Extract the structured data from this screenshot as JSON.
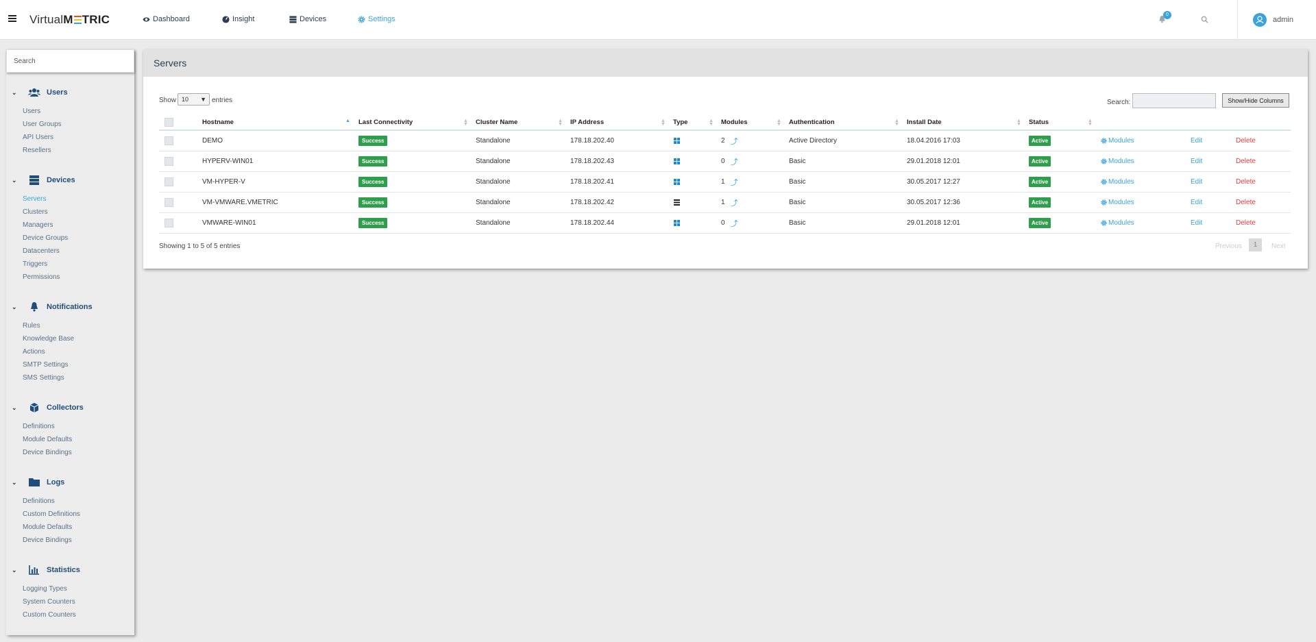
{
  "app": {
    "logo_prefix": "Virtual",
    "logo_m": "M",
    "logo_suffix": "TRIC"
  },
  "nav": {
    "items": [
      {
        "label": "Dashboard",
        "icon": "eye-icon"
      },
      {
        "label": "Insight",
        "icon": "gauge-icon"
      },
      {
        "label": "Devices",
        "icon": "server-icon"
      },
      {
        "label": "Settings",
        "icon": "gear-icon",
        "active": true
      }
    ],
    "notifications_count": "0",
    "user": "admin"
  },
  "sidebar": {
    "search_placeholder": "Search",
    "sections": [
      {
        "title": "Users",
        "icon": "users-icon",
        "items": [
          "Users",
          "User Groups",
          "API Users",
          "Resellers"
        ]
      },
      {
        "title": "Devices",
        "icon": "server-icon",
        "items": [
          "Servers",
          "Clusters",
          "Managers",
          "Device Groups",
          "Datacenters",
          "Triggers",
          "Permissions"
        ],
        "active_item": "Servers"
      },
      {
        "title": "Notifications",
        "icon": "bell-icon",
        "items": [
          "Rules",
          "Knowledge Base",
          "Actions",
          "SMTP Settings",
          "SMS Settings"
        ]
      },
      {
        "title": "Collectors",
        "icon": "cube-icon",
        "items": [
          "Definitions",
          "Module Defaults",
          "Device Bindings"
        ]
      },
      {
        "title": "Logs",
        "icon": "folder-icon",
        "items": [
          "Definitions",
          "Custom Definitions",
          "Module Defaults",
          "Device Bindings"
        ]
      },
      {
        "title": "Statistics",
        "icon": "bar-chart-icon",
        "items": [
          "Logging Types",
          "System Counters",
          "Custom Counters"
        ]
      }
    ]
  },
  "panel": {
    "title": "Servers",
    "show_label": "Show",
    "entries_value": "10",
    "entries_suffix": "entries",
    "search_label": "Search:",
    "columns_button": "Show/Hide Columns",
    "info": "Showing 1 to 5 of 5 entries",
    "pager": {
      "previous": "Previous",
      "page": "1",
      "next": "Next"
    }
  },
  "table": {
    "headers": [
      "Hostname",
      "Last Connectivity",
      "Cluster Name",
      "IP Address",
      "Type",
      "Modules",
      "Authentication",
      "Install Date",
      "Status"
    ],
    "action_labels": {
      "modules": "Modules",
      "edit": "Edit",
      "delete": "Delete"
    },
    "rows": [
      {
        "hostname": "DEMO",
        "connectivity": "Success",
        "cluster": "Standalone",
        "ip": "178.18.202.40",
        "type": "windows-icon",
        "modules": "2",
        "auth": "Active Directory",
        "install_date": "18.04.2016 17:03",
        "status": "Active"
      },
      {
        "hostname": "HYPERV-WIN01",
        "connectivity": "Success",
        "cluster": "Standalone",
        "ip": "178.18.202.43",
        "type": "windows-icon",
        "modules": "0",
        "auth": "Basic",
        "install_date": "29.01.2018 12:01",
        "status": "Active"
      },
      {
        "hostname": "VM-HYPER-V",
        "connectivity": "Success",
        "cluster": "Standalone",
        "ip": "178.18.202.41",
        "type": "windows-icon",
        "modules": "1",
        "auth": "Basic",
        "install_date": "30.05.2017 12:27",
        "status": "Active"
      },
      {
        "hostname": "VM-VMWARE.VMETRIC",
        "connectivity": "Success",
        "cluster": "Standalone",
        "ip": "178.18.202.42",
        "type": "server-icon",
        "modules": "1",
        "auth": "Basic",
        "install_date": "30.05.2017 12:36",
        "status": "Active"
      },
      {
        "hostname": "VMWARE-WIN01",
        "connectivity": "Success",
        "cluster": "Standalone",
        "ip": "178.18.202.44",
        "type": "windows-icon",
        "modules": "0",
        "auth": "Basic",
        "install_date": "29.01.2018 12:01",
        "status": "Active"
      }
    ]
  },
  "colors": {
    "accent": "#3ba3dc",
    "success": "#2e9e4c",
    "danger": "#e0393e",
    "sidebar_heading": "#1e4d7b"
  }
}
